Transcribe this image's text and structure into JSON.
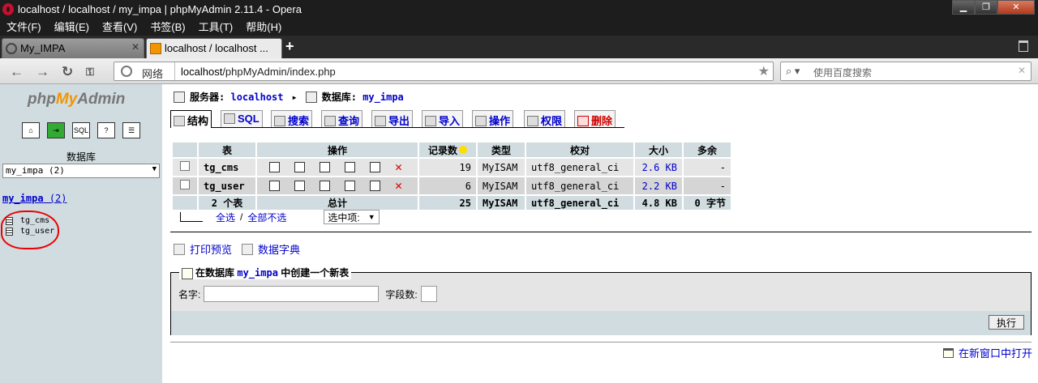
{
  "window": {
    "title": "localhost / localhost / my_impa | phpMyAdmin 2.11.4 - Opera"
  },
  "menu": [
    "文件(F)",
    "编辑(E)",
    "查看(V)",
    "书签(B)",
    "工具(T)",
    "帮助(H)"
  ],
  "tabs": [
    {
      "label": "My_IMPA",
      "active": false
    },
    {
      "label": "localhost / localhost ...",
      "active": true
    }
  ],
  "address": {
    "network_label": "网络",
    "host": "localhost",
    "path": "/phpMyAdmin/index.php"
  },
  "search": {
    "placeholder": "使用百度搜索"
  },
  "sidebar": {
    "logo_php": "php",
    "logo_my": "My",
    "logo_admin": "Admin",
    "db_label": "数据库",
    "db_select": "my_impa (2)",
    "db_name": "my_impa",
    "db_count": "(2)",
    "tables": [
      "tg_cms",
      "tg_user"
    ]
  },
  "breadcrumb": {
    "server_label": "服务器:",
    "server_value": "localhost",
    "db_label": "数据库:",
    "db_value": "my_impa"
  },
  "pma_tabs": [
    "结构",
    "SQL",
    "搜索",
    "查询",
    "导出",
    "导入",
    "操作",
    "权限",
    "删除"
  ],
  "table": {
    "headers": [
      "表",
      "操作",
      "记录数",
      "类型",
      "校对",
      "大小",
      "多余"
    ],
    "rows": [
      {
        "name": "tg_cms",
        "records": "19",
        "type": "MyISAM",
        "collation": "utf8_general_ci",
        "size": "2.6 KB",
        "overhead": "-"
      },
      {
        "name": "tg_user",
        "records": "6",
        "type": "MyISAM",
        "collation": "utf8_general_ci",
        "size": "2.2 KB",
        "overhead": "-"
      }
    ],
    "total": {
      "name": "2 个表",
      "label": "总计",
      "records": "25",
      "type": "MyISAM",
      "collation": "utf8_general_ci",
      "size": "4.8 KB",
      "overhead": "0 字节"
    }
  },
  "selection": {
    "check_all": "全选",
    "sep": "/",
    "uncheck_all": "全部不选",
    "with_selected": "选中项:"
  },
  "tools": {
    "print": "打印预览",
    "dictionary": "数据字典"
  },
  "create": {
    "legend_prefix": "在数据库",
    "legend_db": "my_impa",
    "legend_suffix": "中创建一个新表",
    "name_label": "名字:",
    "fields_label": "字段数:",
    "submit": "执行"
  },
  "new_window": "在新窗口中打开"
}
